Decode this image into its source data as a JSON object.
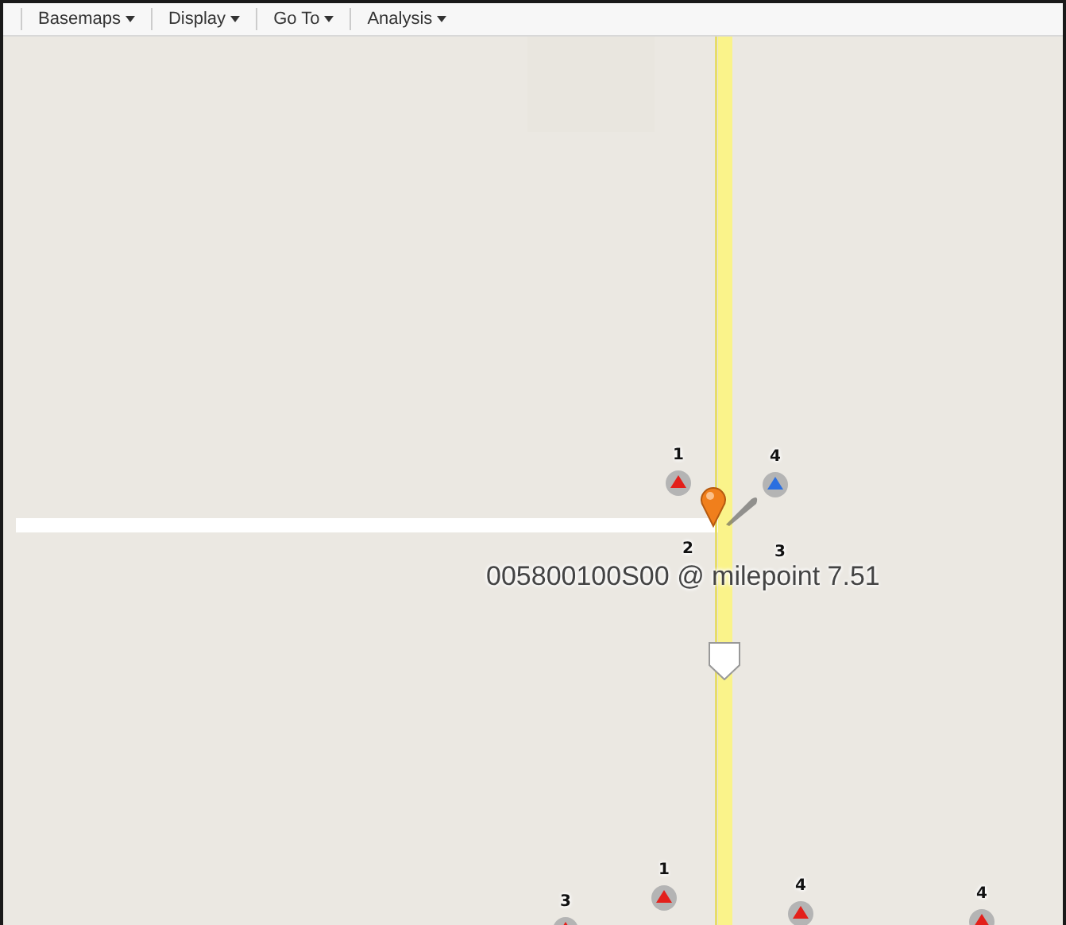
{
  "toolbar": {
    "menus": [
      {
        "label": "Basemaps"
      },
      {
        "label": "Display"
      },
      {
        "label": "Go To"
      },
      {
        "label": "Analysis"
      }
    ]
  },
  "map": {
    "kind": "picture",
    "location_label": "005800100S00 @ milepoint 7.51",
    "stations": [
      {
        "number": "1",
        "kind": "icon",
        "color": "#e3201b"
      },
      {
        "number": "4",
        "kind": "icon",
        "color": "#2b6fe0"
      },
      {
        "number": "2",
        "kind": "number-only"
      },
      {
        "number": "3",
        "kind": "number-only"
      },
      {
        "number": "3",
        "kind": "icon",
        "color": "#e3201b"
      },
      {
        "number": "1",
        "kind": "icon",
        "color": "#e3201b"
      },
      {
        "number": "4",
        "kind": "icon",
        "color": "#e3201b"
      },
      {
        "number": "4",
        "kind": "icon",
        "color": "#e3201b"
      }
    ]
  }
}
